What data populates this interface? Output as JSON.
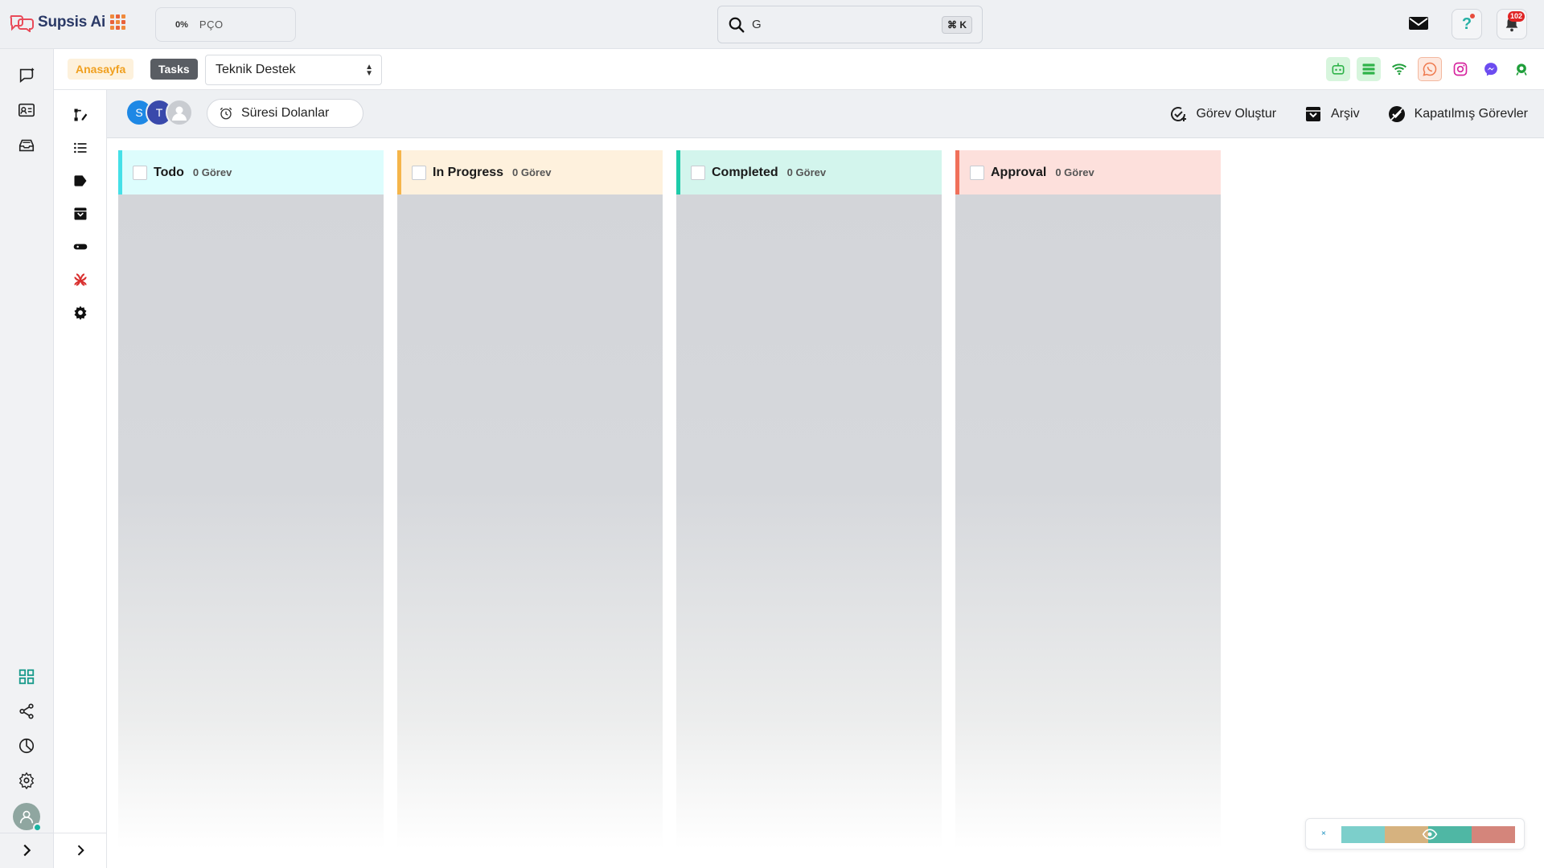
{
  "topbar": {
    "app_name": "Supsis Ai",
    "progress_pct": "0%",
    "progress_label": "PÇO",
    "search_value": "G",
    "search_shortcut": "⌘ K",
    "notification_count": "102"
  },
  "header": {
    "crumb_home": "Anasayfa",
    "crumb_tasks": "Tasks",
    "team_selected": "Teknik Destek",
    "channels": [
      "bot-icon",
      "list-icon",
      "wifi-icon",
      "whatsapp-icon",
      "instagram-icon",
      "messenger-icon",
      "custom-channel-icon"
    ]
  },
  "toolbar": {
    "avatars": [
      {
        "initial": "S",
        "color": "#1e88e5"
      },
      {
        "initial": "T",
        "color": "#3949ab"
      },
      {
        "initial": "",
        "color": "#c9ccd1"
      }
    ],
    "expired_label": "Süresi Dolanlar",
    "create_task_label": "Görev Oluştur",
    "archive_label": "Arşiv",
    "closed_tasks_label": "Kapatılmış Görevler"
  },
  "columns": [
    {
      "title": "Todo",
      "count": "0 Görev",
      "color": "#45e0e8",
      "bg": "#ddfdfd"
    },
    {
      "title": "In Progress",
      "count": "0 Görev",
      "color": "#f5b54a",
      "bg": "#fef1dd"
    },
    {
      "title": "Completed",
      "count": "0 Görev",
      "color": "#1dcba9",
      "bg": "#d3f5ed"
    },
    {
      "title": "Approval",
      "count": "0 Görev",
      "color": "#f0705a",
      "bg": "#fde0dc"
    }
  ],
  "mini_widget": {
    "bar_colors": [
      "#7ccfcb",
      "#d6b27f",
      "#4fb7a4",
      "#d4857b"
    ]
  }
}
